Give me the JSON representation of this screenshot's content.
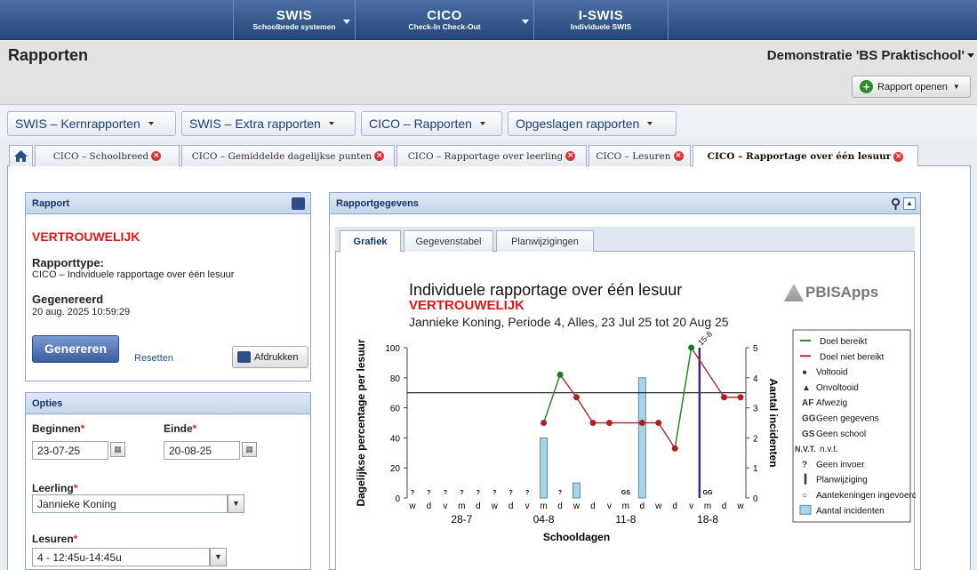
{
  "nav": [
    {
      "title": "SWIS",
      "subtitle": "Schoolbrede systemen"
    },
    {
      "title": "CICO",
      "subtitle": "Check-In Check-Out"
    },
    {
      "title": "I-SWIS",
      "subtitle": "Individuele SWIS"
    }
  ],
  "header": {
    "title": "Rapporten",
    "school": "Demonstratie 'BS Praktischool'",
    "open_report": "Rapport openen"
  },
  "menus": [
    "SWIS – Kernrapporten",
    "SWIS – Extra rapporten",
    "CICO – Rapporten",
    "Opgeslagen rapporten"
  ],
  "report_tabs": [
    "CICO – Schoolbreed",
    "CICO – Gemiddelde dagelijkse punten",
    "CICO – Rapportage over leerling",
    "CICO – Lesuren",
    "CICO – Rapportage over één lesuur"
  ],
  "report_panel": {
    "title": "Rapport",
    "confidential": "VERTROUWELIJK",
    "type_label": "Rapporttype:",
    "type_value": "CICO – Individuele rapportage over één lesuur",
    "generated_label": "Gegenereerd",
    "generated_value": "20 aug. 2025 10:59:29",
    "generate": "Genereren",
    "reset": "Resetten",
    "print": "Afdrukken"
  },
  "options": {
    "title": "Opties",
    "start_label": "Beginnen",
    "start_value": "23-07-25",
    "end_label": "Einde",
    "end_value": "20-08-25",
    "student_label": "Leerling",
    "student_value": "Jannieke Koning",
    "period_label": "Lesuren",
    "period_value": "4 - 12:45u-14:45u"
  },
  "data_panel": {
    "title": "Rapportgegevens",
    "tabs": [
      "Grafiek",
      "Gegevenstabel",
      "Planwijzigingen"
    ]
  },
  "chart_data": {
    "type": "line",
    "title": "Individuele rapportage over één lesuur",
    "subtitle": "VERTROUWELIJK",
    "caption": "Jannieke Koning, Periode 4, Alles, 23 Jul 25 tot 20 Aug 25",
    "logo": "PBISApps",
    "xlabel": "Schooldagen",
    "ylabel": "Dagelijkse percentage per lesuur",
    "y2label": "Aantal incidenten",
    "ylim": [
      0,
      100
    ],
    "y2lim": [
      0,
      5
    ],
    "yticks": [
      0,
      20,
      40,
      60,
      80,
      100
    ],
    "y2ticks": [
      0,
      1,
      2,
      3,
      4,
      5
    ],
    "goal": 70,
    "days": [
      "w",
      "d",
      "v",
      "m",
      "d",
      "w",
      "d",
      "v",
      "m",
      "d",
      "w",
      "d",
      "v",
      "m",
      "d",
      "w",
      "d",
      "v",
      "m",
      "d",
      "w"
    ],
    "week_labels": [
      {
        "label": "28-7",
        "day": 3
      },
      {
        "label": "04-8",
        "day": 8
      },
      {
        "label": "11-8",
        "day": 13
      },
      {
        "label": "18-8",
        "day": 18
      }
    ],
    "points": [
      null,
      null,
      null,
      null,
      null,
      null,
      null,
      null,
      50,
      null,
      82,
      67,
      50,
      50,
      null,
      null,
      50,
      50,
      33,
      null,
      100,
      null,
      67,
      67
    ],
    "point_days": [
      0,
      1,
      2,
      3,
      4,
      5,
      6,
      7,
      8,
      null,
      9,
      10,
      11,
      12,
      null,
      null,
      14,
      15,
      16,
      null,
      17,
      null,
      19,
      20
    ],
    "values": [
      {
        "day": 8,
        "y": 50
      },
      {
        "day": 9,
        "y": 82
      },
      {
        "day": 10,
        "y": 67
      },
      {
        "day": 11,
        "y": 50
      },
      {
        "day": 12,
        "y": 50
      },
      {
        "day": 14,
        "y": 50
      },
      {
        "day": 15,
        "y": 50
      },
      {
        "day": 16,
        "y": 33
      },
      {
        "day": 17,
        "y": 100
      },
      {
        "day": 19,
        "y": 67
      },
      {
        "day": 20,
        "y": 67
      }
    ],
    "incidents": [
      {
        "day": 8,
        "count": 2
      },
      {
        "day": 10,
        "count": 0.5
      },
      {
        "day": 14,
        "count": 4
      }
    ],
    "plan_change_day": 17.5,
    "plan_change_label": "15-8",
    "markers": [
      {
        "day": 0,
        "text": "?"
      },
      {
        "day": 1,
        "text": "?"
      },
      {
        "day": 2,
        "text": "?"
      },
      {
        "day": 3,
        "text": "?"
      },
      {
        "day": 4,
        "text": "?"
      },
      {
        "day": 5,
        "text": "?"
      },
      {
        "day": 6,
        "text": "?"
      },
      {
        "day": 7,
        "text": "?"
      },
      {
        "day": 9,
        "text": "?"
      },
      {
        "day": 13,
        "text": "GS"
      },
      {
        "day": 18,
        "text": "GG"
      }
    ],
    "legend": [
      {
        "sym": "line-green",
        "label": "Doel bereikt"
      },
      {
        "sym": "line-red",
        "label": "Doel niet bereikt"
      },
      {
        "sym": "●",
        "label": "Voltooid"
      },
      {
        "sym": "▲",
        "label": "Onvoltooid"
      },
      {
        "sym": "AF",
        "label": "Afwezig"
      },
      {
        "sym": "GG",
        "label": "Geen gegevens"
      },
      {
        "sym": "GS",
        "label": "Geen school"
      },
      {
        "sym": "N.V.T.",
        "label": "n.v.t."
      },
      {
        "sym": "?",
        "label": "Geen invoer"
      },
      {
        "sym": "|",
        "label": "Planwijziging"
      },
      {
        "sym": "○",
        "label": "Aantekeningen ingevoerd"
      },
      {
        "sym": "box",
        "label": "Aantal incidenten"
      }
    ]
  }
}
